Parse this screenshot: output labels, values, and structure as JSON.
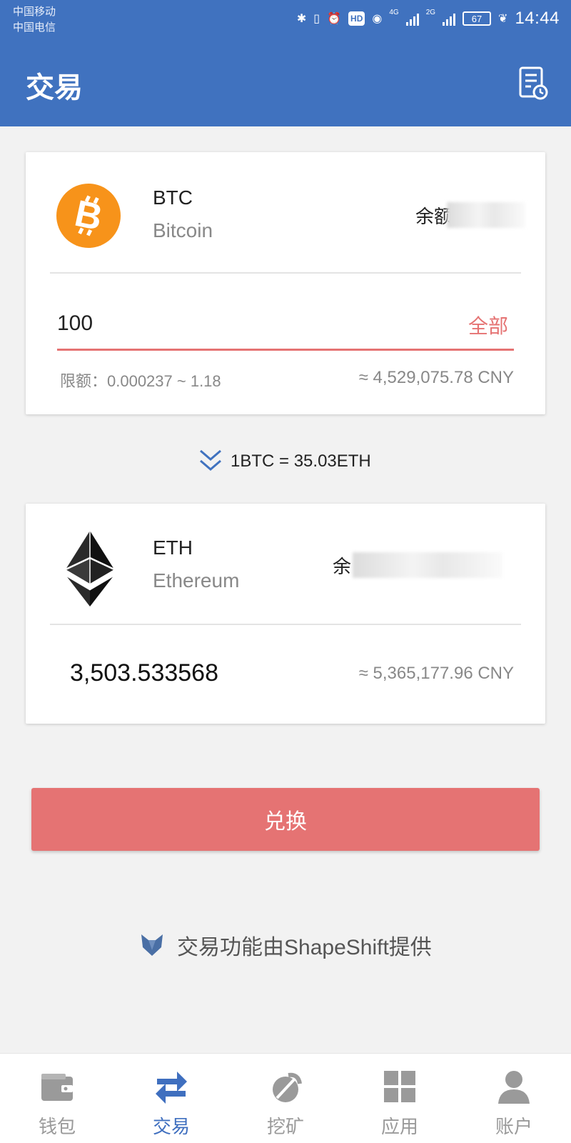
{
  "status_bar": {
    "carrier_1": "中国移动",
    "carrier_2": "中国电信",
    "hd": "HD",
    "net_1": "4G",
    "net_2": "2G",
    "battery": "67",
    "time": "14:44"
  },
  "header": {
    "title": "交易",
    "history_icon": "history-document-icon"
  },
  "from_card": {
    "symbol": "BTC",
    "name": "Bitcoin",
    "balance_label": "余额",
    "amount_value": "100",
    "all_label": "全部",
    "limit_text": "限额：0.000237 ~ 1.18",
    "approx_value": "≈ 4,529,075.78 CNY",
    "icon": "bitcoin-icon",
    "accent_color": "#f7931a"
  },
  "rate": {
    "text": "1BTC = 35.03ETH",
    "icon": "double-chevron-down-icon"
  },
  "to_card": {
    "symbol": "ETH",
    "name": "Ethereum",
    "balance_label": "余",
    "amount_value": "3,503.533568",
    "approx_value": "≈ 5,365,177.96 CNY",
    "icon": "ethereum-icon"
  },
  "exchange_button": {
    "label": "兑换",
    "color": "#e57373"
  },
  "provider": {
    "text": "交易功能由ShapeShift提供",
    "icon": "fox-icon"
  },
  "bottom_nav": {
    "items": [
      {
        "label": "钱包",
        "icon": "wallet-icon"
      },
      {
        "label": "交易",
        "icon": "exchange-arrows-icon"
      },
      {
        "label": "挖矿",
        "icon": "pickaxe-icon"
      },
      {
        "label": "应用",
        "icon": "apps-grid-icon"
      },
      {
        "label": "账户",
        "icon": "user-icon"
      }
    ],
    "active_index": 1
  },
  "colors": {
    "primary": "#4072bf",
    "accent": "#e57373",
    "background": "#f2f2f2"
  }
}
